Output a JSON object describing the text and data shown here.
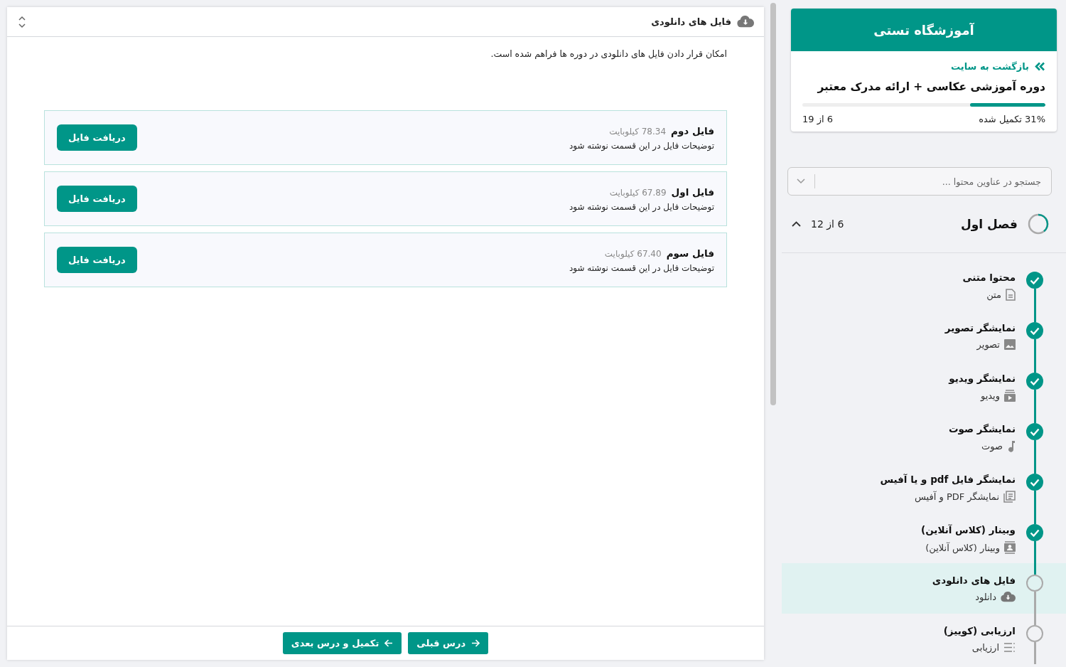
{
  "main": {
    "title": "فایل های دانلودی",
    "description": "امکان قرار دادن فایل های دانلودی در دوره ها فراهم شده است.",
    "files": [
      {
        "name": "فایل دوم",
        "size": "78.34 کیلوبایت",
        "description": "توضیحات فایل در این قسمت نوشته شود",
        "button": "دریافت فایل"
      },
      {
        "name": "فایل اول",
        "size": "67.89 کیلوبایت",
        "description": "توضیحات فایل در این قسمت نوشته شود",
        "button": "دریافت فایل"
      },
      {
        "name": "فایل سوم",
        "size": "67.40 کیلوبایت",
        "description": "توضیحات فایل در این قسمت نوشته شود",
        "button": "دریافت فایل"
      }
    ]
  },
  "footer": {
    "buttons": [
      {
        "label": "درس قبلی",
        "kind": "previous"
      },
      {
        "label": "تکمیل و درس بعدی",
        "kind": "next"
      }
    ]
  },
  "sidebar": {
    "school": "آموزشگاه تستی",
    "back_link": "بازگشت به سایت",
    "course_title": "دوره آموزشی عکاسی + ارائه مدرک معتبر",
    "progress": {
      "level": 0.31,
      "percent": "31% تکمیل شده",
      "count": "6 از 19"
    },
    "search": {
      "placeholder": "جستجو در عناوین محتوا ..."
    },
    "chapter": {
      "title": "فصل اول",
      "count": "6 از 12",
      "expanded": true,
      "lessons": [
        {
          "title": "محتوا متنی",
          "subtitle": "متن",
          "kind": "text",
          "done": true,
          "selected": false
        },
        {
          "title": "نمایشگر تصویر",
          "subtitle": "تصویر",
          "kind": "image",
          "done": true,
          "selected": false
        },
        {
          "title": "نمایشگر ویدیو",
          "subtitle": "ویدیو",
          "kind": "video",
          "done": true,
          "selected": false
        },
        {
          "title": "نمایشگر صوت",
          "subtitle": "صوت",
          "kind": "audio",
          "done": true,
          "selected": false
        },
        {
          "title": "نمایشگر فایل pdf و یا آفیس",
          "subtitle": "نمایشگر PDF و آفیس",
          "kind": "document",
          "done": true,
          "selected": false
        },
        {
          "title": "وبینار (کلاس آنلاین)",
          "subtitle": "وبینار (کلاس آنلاین)",
          "kind": "webinar",
          "done": true,
          "selected": false
        },
        {
          "title": "فایل های دانلودی",
          "subtitle": "دانلود",
          "kind": "download",
          "done": false,
          "selected": true
        },
        {
          "title": "ارزیابی (کوییز)",
          "subtitle": "ارزیابی",
          "kind": "quiz",
          "done": false,
          "selected": false
        }
      ]
    }
  }
}
